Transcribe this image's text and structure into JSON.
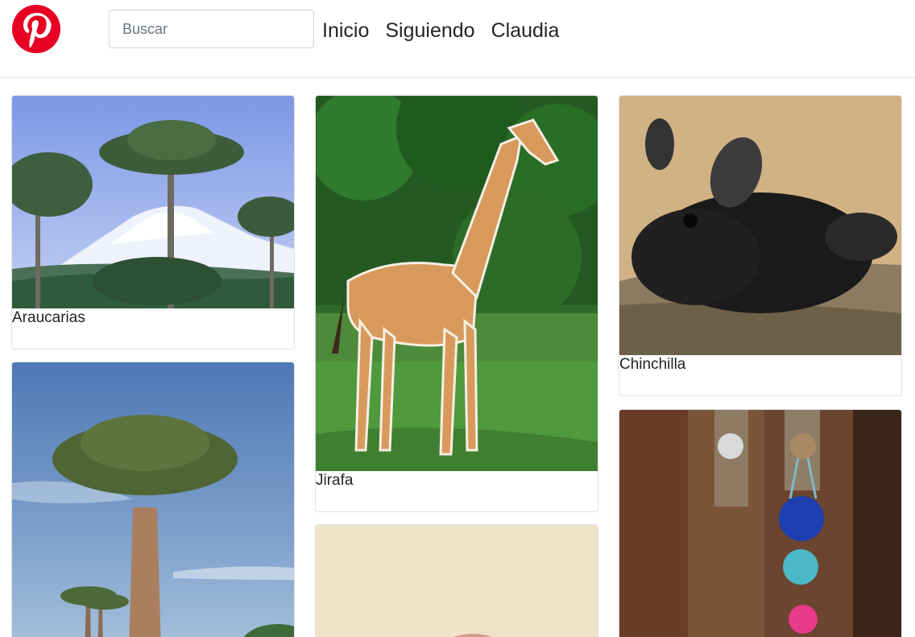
{
  "header": {
    "logo": "pinterest-logo",
    "search_placeholder": "Buscar",
    "nav": [
      "Inicio",
      "Siguiendo",
      "Claudia"
    ]
  },
  "pins": [
    {
      "caption": "Araucarias",
      "image": "araucaria-trees-volcano-photo"
    },
    {
      "caption": "",
      "image": "baobab-tree-photo"
    },
    {
      "caption": "Jirafa",
      "image": "giraffe-photo"
    },
    {
      "caption": "",
      "image": "beige-photo"
    },
    {
      "caption": "Chinchilla",
      "image": "chinchilla-photo"
    },
    {
      "caption": "",
      "image": "door-pompoms-photo"
    }
  ],
  "colors": {
    "brand": "#e60023",
    "border": "#dee2e6"
  }
}
